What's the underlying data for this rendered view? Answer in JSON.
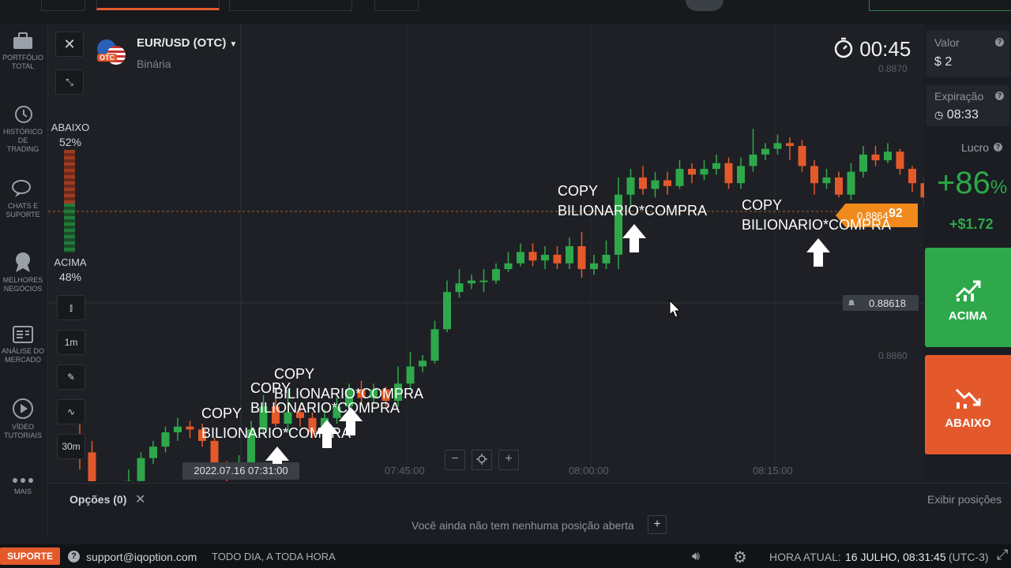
{
  "asset": {
    "name": "EUR/USD (OTC)",
    "type": "Binária",
    "badge": "OTC"
  },
  "timer": "00:45",
  "sidebar": [
    {
      "label": "PORTFÓLIO\nTOTAL",
      "icon": "briefcase-icon"
    },
    {
      "label": "HISTÓRICO DE\nTRADING",
      "icon": "history-icon"
    },
    {
      "label": "CHATS E\nSUPORTE",
      "icon": "chat-icon"
    },
    {
      "label": "MELHORES\nNEGÓCIOS",
      "icon": "award-icon"
    },
    {
      "label": "ANÁLISE DO\nMERCADO",
      "icon": "analysis-icon"
    },
    {
      "label": "VÍDEO\nTUTORIAIS",
      "icon": "play-icon"
    },
    {
      "label": "MAIS",
      "icon": "more-icon"
    }
  ],
  "sentiment": {
    "down_label": "ABAIXO",
    "down_pct": "52%",
    "up_label": "ACIMA",
    "up_pct": "48%"
  },
  "tools": {
    "timeframe": "1m",
    "expiry": "30m"
  },
  "price_axis": {
    "top": "0.8870",
    "mid": "0.8860",
    "current": "0.886492",
    "current_main": "0.8864",
    "current_tail": "92",
    "crosshair": "0.88618"
  },
  "time_axis": {
    "cursor": "2022.07.16 07:31:00",
    "t1": "07:45:00",
    "t2": "08:00:00",
    "t3": "08:15:00"
  },
  "annotations": {
    "copy": "COPY",
    "signal": "BILIONARIO*COMPRA"
  },
  "right": {
    "valor_label": "Valor",
    "valor": "$ 2",
    "exp_label": "Expiração",
    "exp": "08:33",
    "profit_label": "Lucro",
    "profit_pct": "+86",
    "pct": "%",
    "profit_amt": "+$1.72",
    "up_btn": "ACIMA",
    "down_btn": "ABAIXO"
  },
  "positions": {
    "tab": "Opções (0)",
    "empty": "Você ainda não tem nenhuma posição aberta",
    "show": "Exibir posições"
  },
  "footer": {
    "support_btn": "SUPORTE",
    "email": "support@iqoption.com",
    "hours": "TODO DIA, A TODA HORA",
    "time_label": "HORA ATUAL:",
    "time": "16 JULHO, 08:31:45",
    "tz": "(UTC-3)"
  },
  "colors": {
    "up": "#2ea84a",
    "down": "#e4592b",
    "price_tag": "#f08a1c"
  },
  "chart_data": {
    "type": "candlestick",
    "timeframe": "1m",
    "ylim": [
      0.8855,
      0.8871
    ],
    "series": [
      {
        "o": 0.88572,
        "c": 0.88566,
        "h": 0.88576,
        "l": 0.8856
      },
      {
        "o": 0.88566,
        "c": 0.88551,
        "h": 0.8857,
        "l": 0.88545
      },
      {
        "o": 0.88551,
        "c": 0.88546,
        "h": 0.88554,
        "l": 0.88541
      },
      {
        "o": 0.88546,
        "c": 0.88548,
        "h": 0.88552,
        "l": 0.88538
      },
      {
        "o": 0.88548,
        "c": 0.88556,
        "h": 0.8856,
        "l": 0.88546
      },
      {
        "o": 0.88556,
        "c": 0.88564,
        "h": 0.88566,
        "l": 0.88555
      },
      {
        "o": 0.88564,
        "c": 0.88568,
        "h": 0.8857,
        "l": 0.88562
      },
      {
        "o": 0.88568,
        "c": 0.88573,
        "h": 0.88575,
        "l": 0.88566
      },
      {
        "o": 0.88573,
        "c": 0.88575,
        "h": 0.88578,
        "l": 0.8857
      },
      {
        "o": 0.88575,
        "c": 0.88574,
        "h": 0.88577,
        "l": 0.88571
      },
      {
        "o": 0.88574,
        "c": 0.8857,
        "h": 0.88576,
        "l": 0.88568
      },
      {
        "o": 0.8857,
        "c": 0.88561,
        "h": 0.88571,
        "l": 0.88558
      },
      {
        "o": 0.88561,
        "c": 0.88558,
        "h": 0.88563,
        "l": 0.88554
      },
      {
        "o": 0.88558,
        "c": 0.88562,
        "h": 0.88565,
        "l": 0.88557
      },
      {
        "o": 0.88562,
        "c": 0.88574,
        "h": 0.88577,
        "l": 0.8856
      },
      {
        "o": 0.88574,
        "c": 0.88582,
        "h": 0.88586,
        "l": 0.88572
      },
      {
        "o": 0.88582,
        "c": 0.88576,
        "h": 0.88586,
        "l": 0.88575
      },
      {
        "o": 0.88576,
        "c": 0.8858,
        "h": 0.88588,
        "l": 0.88573
      },
      {
        "o": 0.8858,
        "c": 0.88578,
        "h": 0.88582,
        "l": 0.88575
      },
      {
        "o": 0.88578,
        "c": 0.88573,
        "h": 0.8858,
        "l": 0.88571
      },
      {
        "o": 0.88573,
        "c": 0.88578,
        "h": 0.88581,
        "l": 0.88571
      },
      {
        "o": 0.88578,
        "c": 0.88582,
        "h": 0.88585,
        "l": 0.88576
      },
      {
        "o": 0.88582,
        "c": 0.88588,
        "h": 0.8859,
        "l": 0.8858
      },
      {
        "o": 0.88588,
        "c": 0.88585,
        "h": 0.88591,
        "l": 0.88583
      },
      {
        "o": 0.88585,
        "c": 0.88588,
        "h": 0.8859,
        "l": 0.88583
      },
      {
        "o": 0.88588,
        "c": 0.88584,
        "h": 0.88589,
        "l": 0.88582
      },
      {
        "o": 0.88584,
        "c": 0.8859,
        "h": 0.88596,
        "l": 0.88582
      },
      {
        "o": 0.8859,
        "c": 0.88596,
        "h": 0.88601,
        "l": 0.88588
      },
      {
        "o": 0.88596,
        "c": 0.88598,
        "h": 0.886,
        "l": 0.88594
      },
      {
        "o": 0.88598,
        "c": 0.88609,
        "h": 0.88612,
        "l": 0.88597
      },
      {
        "o": 0.88609,
        "c": 0.88622,
        "h": 0.88626,
        "l": 0.88608
      },
      {
        "o": 0.88622,
        "c": 0.88625,
        "h": 0.8863,
        "l": 0.8862
      },
      {
        "o": 0.88625,
        "c": 0.88626,
        "h": 0.88628,
        "l": 0.88623
      },
      {
        "o": 0.88626,
        "c": 0.88626,
        "h": 0.8863,
        "l": 0.88622
      },
      {
        "o": 0.88626,
        "c": 0.8863,
        "h": 0.88632,
        "l": 0.88625
      },
      {
        "o": 0.8863,
        "c": 0.88632,
        "h": 0.88636,
        "l": 0.88629
      },
      {
        "o": 0.88632,
        "c": 0.88636,
        "h": 0.88639,
        "l": 0.88631
      },
      {
        "o": 0.88636,
        "c": 0.88633,
        "h": 0.88639,
        "l": 0.88631
      },
      {
        "o": 0.88633,
        "c": 0.88635,
        "h": 0.88638,
        "l": 0.8863
      },
      {
        "o": 0.88635,
        "c": 0.88632,
        "h": 0.88638,
        "l": 0.8863
      },
      {
        "o": 0.88632,
        "c": 0.88638,
        "h": 0.88641,
        "l": 0.8863
      },
      {
        "o": 0.88638,
        "c": 0.8863,
        "h": 0.88643,
        "l": 0.88627
      },
      {
        "o": 0.8863,
        "c": 0.88632,
        "h": 0.88635,
        "l": 0.88628
      },
      {
        "o": 0.88632,
        "c": 0.88635,
        "h": 0.8864,
        "l": 0.8863
      },
      {
        "o": 0.88635,
        "c": 0.88656,
        "h": 0.88662,
        "l": 0.8863
      },
      {
        "o": 0.88656,
        "c": 0.88662,
        "h": 0.88665,
        "l": 0.88652
      },
      {
        "o": 0.88662,
        "c": 0.88658,
        "h": 0.88666,
        "l": 0.88656
      },
      {
        "o": 0.88658,
        "c": 0.88661,
        "h": 0.88664,
        "l": 0.88655
      },
      {
        "o": 0.88661,
        "c": 0.88659,
        "h": 0.88664,
        "l": 0.88656
      },
      {
        "o": 0.88659,
        "c": 0.88665,
        "h": 0.88668,
        "l": 0.88658
      },
      {
        "o": 0.88665,
        "c": 0.88663,
        "h": 0.88667,
        "l": 0.8866
      },
      {
        "o": 0.88663,
        "c": 0.88665,
        "h": 0.88668,
        "l": 0.88661
      },
      {
        "o": 0.88665,
        "c": 0.88667,
        "h": 0.8867,
        "l": 0.88663
      },
      {
        "o": 0.88667,
        "c": 0.8866,
        "h": 0.88669,
        "l": 0.88658
      },
      {
        "o": 0.8866,
        "c": 0.88666,
        "h": 0.88669,
        "l": 0.88658
      },
      {
        "o": 0.88666,
        "c": 0.8867,
        "h": 0.88679,
        "l": 0.88664
      },
      {
        "o": 0.8867,
        "c": 0.88672,
        "h": 0.88674,
        "l": 0.88668
      },
      {
        "o": 0.88672,
        "c": 0.88674,
        "h": 0.88677,
        "l": 0.8867
      },
      {
        "o": 0.88674,
        "c": 0.88673,
        "h": 0.88676,
        "l": 0.88668
      },
      {
        "o": 0.88673,
        "c": 0.88666,
        "h": 0.88675,
        "l": 0.88664
      },
      {
        "o": 0.88666,
        "c": 0.8866,
        "h": 0.88668,
        "l": 0.88656
      },
      {
        "o": 0.8866,
        "c": 0.88662,
        "h": 0.88665,
        "l": 0.88658
      },
      {
        "o": 0.88662,
        "c": 0.88656,
        "h": 0.88664,
        "l": 0.88655
      },
      {
        "o": 0.88656,
        "c": 0.88664,
        "h": 0.88667,
        "l": 0.88654
      },
      {
        "o": 0.88664,
        "c": 0.8867,
        "h": 0.88673,
        "l": 0.88662
      },
      {
        "o": 0.8867,
        "c": 0.88668,
        "h": 0.88673,
        "l": 0.88666
      },
      {
        "o": 0.88668,
        "c": 0.88671,
        "h": 0.88674,
        "l": 0.88667
      },
      {
        "o": 0.88671,
        "c": 0.88665,
        "h": 0.88672,
        "l": 0.88663
      },
      {
        "o": 0.88665,
        "c": 0.8866,
        "h": 0.88666,
        "l": 0.88657
      },
      {
        "o": 0.8866,
        "c": 0.88655,
        "h": 0.88662,
        "l": 0.88652
      },
      {
        "o": 0.88655,
        "c": 0.88661,
        "h": 0.88664,
        "l": 0.88653
      },
      {
        "o": 0.88661,
        "c": 0.88657,
        "h": 0.88667,
        "l": 0.88655
      },
      {
        "o": 0.88657,
        "c": 0.88646,
        "h": 0.88659,
        "l": 0.88644
      },
      {
        "o": 0.88646,
        "c": 0.88656,
        "h": 0.88659,
        "l": 0.88644
      },
      {
        "o": 0.88656,
        "c": 0.88653,
        "h": 0.88659,
        "l": 0.8865
      },
      {
        "o": 0.88653,
        "c": 0.88655,
        "h": 0.8866,
        "l": 0.88651
      },
      {
        "o": 0.88655,
        "c": 0.8865,
        "h": 0.88656,
        "l": 0.88648
      },
      {
        "o": 0.8865,
        "c": 0.88648,
        "h": 0.88652,
        "l": 0.88645
      },
      {
        "o": 0.88648,
        "c": 0.88646,
        "h": 0.8865,
        "l": 0.88643
      }
    ]
  }
}
